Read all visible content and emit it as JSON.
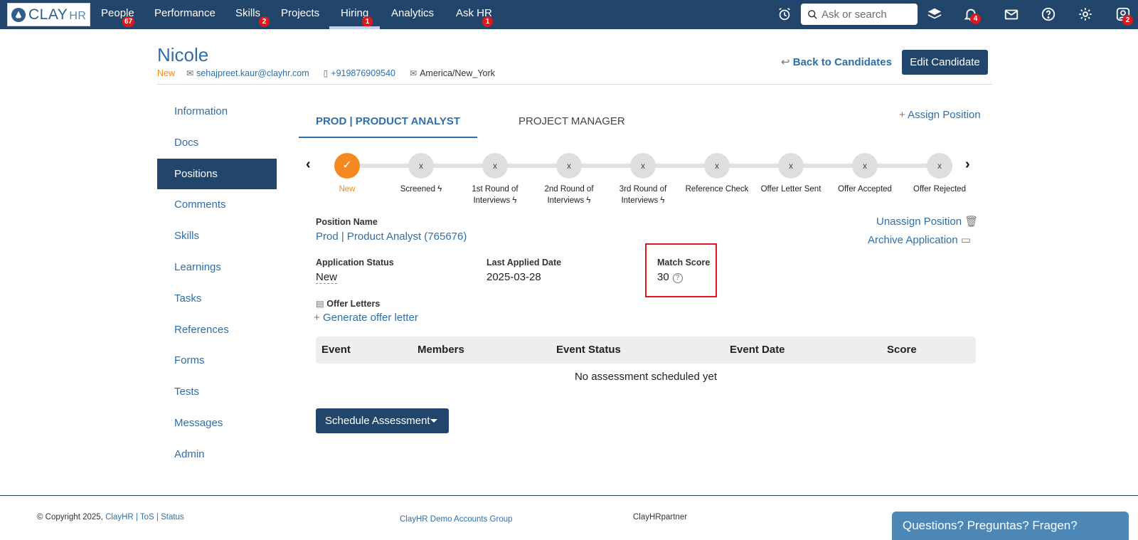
{
  "brand": {
    "name": "CLAY",
    "suffix": "HR"
  },
  "nav": {
    "items": [
      {
        "label": "People",
        "badge": "67"
      },
      {
        "label": "Performance",
        "badge": ""
      },
      {
        "label": "Skills",
        "badge": "2"
      },
      {
        "label": "Projects",
        "badge": ""
      },
      {
        "label": "Hiring",
        "badge": "1",
        "active": true
      },
      {
        "label": "Analytics",
        "badge": ""
      },
      {
        "label": "Ask HR",
        "badge": "1"
      }
    ],
    "search_placeholder": "Ask or search",
    "notifications_badge": "4",
    "profile_badge": "2",
    "icons": [
      "alarm-clock-icon",
      "search-icon",
      "layers-icon",
      "bell-icon",
      "mail-icon",
      "help-icon",
      "gear-icon",
      "user-icon"
    ]
  },
  "candidate": {
    "name": "Nicole",
    "status": "New",
    "email": "sehajpreet.kaur@clayhr.com",
    "phone": "+919876909540",
    "timezone": "America/New_York"
  },
  "header": {
    "back_label": "Back to Candidates",
    "edit_label": "Edit Candidate"
  },
  "sidebar": {
    "items": [
      "Information",
      "Docs",
      "Positions",
      "Comments",
      "Skills",
      "Learnings",
      "Tasks",
      "References",
      "Forms",
      "Tests",
      "Messages",
      "Admin"
    ],
    "active": "Positions"
  },
  "tabs": {
    "active": "PROD | PRODUCT ANALYST",
    "other": "PROJECT MANAGER",
    "assign_label": "Assign Position"
  },
  "pipeline": {
    "stages": [
      {
        "label": "New",
        "done": true,
        "mark": "✓"
      },
      {
        "label": "Screened",
        "done": false,
        "mark": "x",
        "auto": true
      },
      {
        "label": "1st Round of Interviews",
        "done": false,
        "mark": "x",
        "auto": true
      },
      {
        "label": "2nd Round of Interviews",
        "done": false,
        "mark": "x",
        "auto": true
      },
      {
        "label": "3rd Round of Interviews",
        "done": false,
        "mark": "x",
        "auto": true
      },
      {
        "label": "Reference Check",
        "done": false,
        "mark": "x"
      },
      {
        "label": "Offer Letter Sent",
        "done": false,
        "mark": "x"
      },
      {
        "label": "Offer Accepted",
        "done": false,
        "mark": "x"
      },
      {
        "label": "Offer Rejected",
        "done": false,
        "mark": "x"
      }
    ]
  },
  "position": {
    "name_label": "Position Name",
    "name_value": "Prod | Product Analyst (765676)",
    "unassign_label": "Unassign Position",
    "archive_label": "Archive Application",
    "status_label": "Application Status",
    "status_value": "New",
    "applied_label": "Last Applied Date",
    "applied_value": "2025-03-28",
    "match_label": "Match Score",
    "match_value": "30",
    "offer_label": "Offer Letters",
    "generate_label": "Generate offer letter"
  },
  "assessments": {
    "columns": [
      "Event",
      "Members",
      "Event Status",
      "Event Date",
      "Score"
    ],
    "empty_text": "No assessment scheduled yet",
    "schedule_label": "Schedule Assessment"
  },
  "footer": {
    "copyright": "© Copyright 2025,",
    "brand_link": "ClayHR",
    "tos": "ToS",
    "status": "Status",
    "group": "ClayHR Demo Accounts Group",
    "partner": "ClayHRpartner",
    "chat": "Questions? Preguntas? Fragen?"
  },
  "colors": {
    "nav_bg": "#22456b",
    "link": "#2f6fa8",
    "accent_orange": "#f5891f",
    "badge_red": "#e0181b",
    "chat_bg": "#4d87b5"
  }
}
